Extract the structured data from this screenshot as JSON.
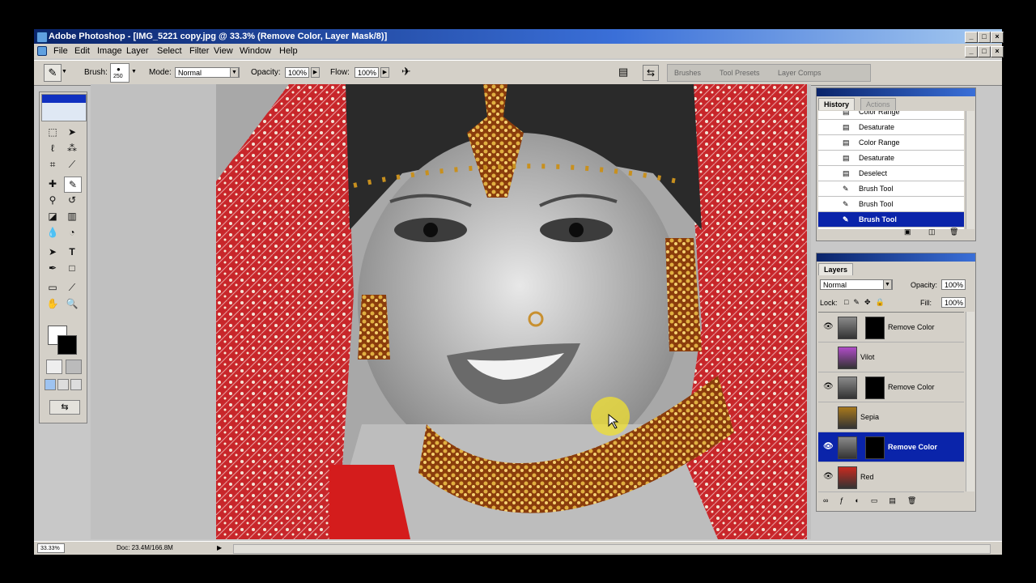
{
  "window": {
    "title": "Adobe Photoshop - [IMG_5221 copy.jpg @ 33.3% (Remove Color, Layer Mask/8)]"
  },
  "menu": [
    "File",
    "Edit",
    "Image",
    "Layer",
    "Select",
    "Filter",
    "View",
    "Window",
    "Help"
  ],
  "options": {
    "brush_label": "Brush:",
    "brush_size": "250",
    "mode_label": "Mode:",
    "mode_value": "Normal",
    "opacity_label": "Opacity:",
    "opacity_value": "100%",
    "flow_label": "Flow:",
    "flow_value": "100%"
  },
  "palette_well": [
    "Brushes",
    "Tool Presets",
    "Layer Comps"
  ],
  "history": {
    "tabs": [
      "History",
      "Actions"
    ],
    "items": [
      {
        "label": "Color Range",
        "icon": "document-icon"
      },
      {
        "label": "Desaturate",
        "icon": "document-icon"
      },
      {
        "label": "Color Range",
        "icon": "document-icon"
      },
      {
        "label": "Desaturate",
        "icon": "document-icon"
      },
      {
        "label": "Deselect",
        "icon": "document-icon"
      },
      {
        "label": "Brush Tool",
        "icon": "brush-icon"
      },
      {
        "label": "Brush Tool",
        "icon": "brush-icon"
      },
      {
        "label": "Brush Tool",
        "icon": "brush-icon",
        "selected": true
      }
    ]
  },
  "layers": {
    "tab": "Layers",
    "blend_mode": "Normal",
    "opacity_label": "Opacity:",
    "opacity_value": "100%",
    "lock_label": "Lock:",
    "fill_label": "Fill:",
    "fill_value": "100%",
    "items": [
      {
        "name": "Remove Color",
        "visible": true,
        "mask": true
      },
      {
        "name": "Vilot",
        "visible": false,
        "mask": false
      },
      {
        "name": "Remove Color",
        "visible": true,
        "mask": true
      },
      {
        "name": "Sepia",
        "visible": false,
        "mask": false
      },
      {
        "name": "Remove Color",
        "visible": true,
        "mask": true,
        "selected": true
      },
      {
        "name": "Red",
        "visible": true,
        "mask": false
      }
    ]
  },
  "status": {
    "zoom": "33.33%",
    "doc": "Doc: 23.4M/166.8M"
  },
  "colors": {
    "title_bar": "#0a246a",
    "selection": "#0a24aa",
    "chrome": "#d4d0c8"
  }
}
